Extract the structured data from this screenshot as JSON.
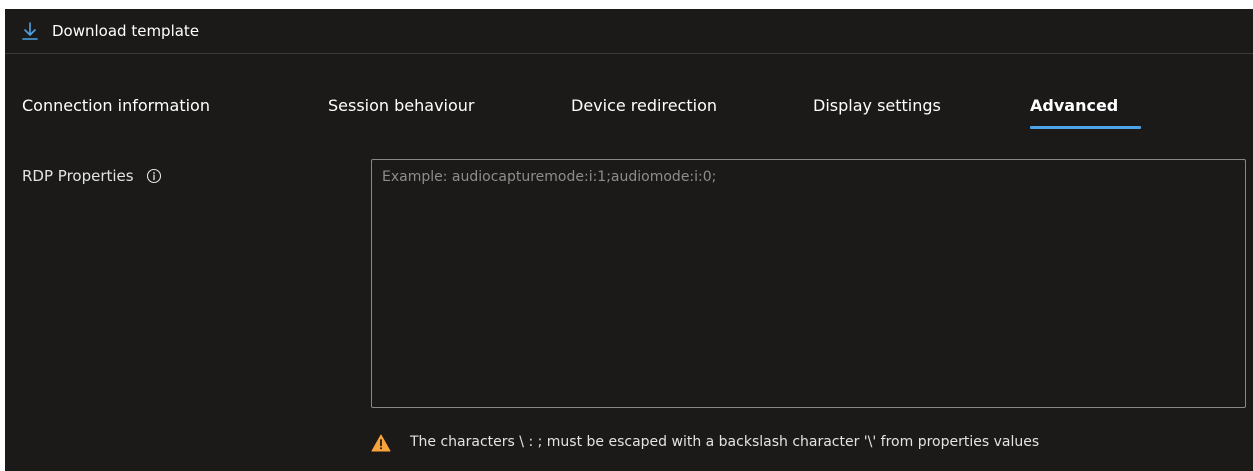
{
  "toolbar": {
    "download_label": "Download template",
    "download_icon": "download-arrow-icon"
  },
  "tabs": [
    {
      "label": "Connection information",
      "active": false
    },
    {
      "label": "Session behaviour",
      "active": false
    },
    {
      "label": "Device redirection",
      "active": false
    },
    {
      "label": "Display settings",
      "active": false
    },
    {
      "label": "Advanced",
      "active": true
    }
  ],
  "rdp": {
    "label": "RDP Properties",
    "info_icon": "info-icon",
    "value": "",
    "placeholder": "Example: audiocapturemode:i:1;audiomode:i:0;"
  },
  "warning": {
    "icon": "warning-triangle-icon",
    "text": "The characters \\ : ; must be escaped with a backslash character '\\' from properties values"
  },
  "colors": {
    "background": "#1b1a19",
    "accent": "#4da3e8",
    "warning": "#f7a23b",
    "border": "#8a8886"
  }
}
